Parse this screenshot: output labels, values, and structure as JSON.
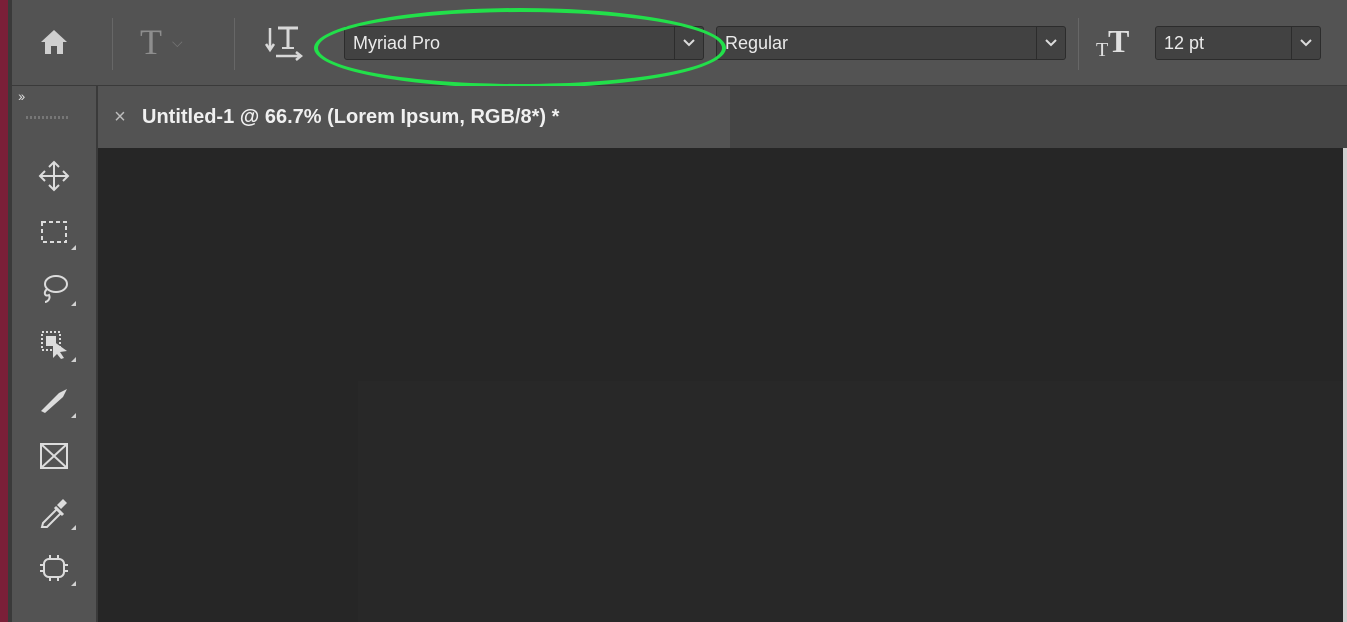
{
  "options_bar": {
    "font_family": "Myriad Pro",
    "font_style": "Regular",
    "font_size": "12 pt",
    "type_tool_glyph": "T",
    "size_glyph": "T",
    "home_icon": "home-icon",
    "orientation_icon": "text-orientation-icon"
  },
  "document_tab": {
    "close_glyph": "×",
    "title": "Untitled-1 @ 66.7% (Lorem Ipsum, RGB/8*) *"
  },
  "toolbar": {
    "collapse_glyph": "››",
    "tools": [
      {
        "name": "move-tool-icon"
      },
      {
        "name": "marquee-tool-icon"
      },
      {
        "name": "lasso-tool-icon"
      },
      {
        "name": "object-selection-tool-icon"
      },
      {
        "name": "crop-tool-icon"
      },
      {
        "name": "frame-tool-icon"
      },
      {
        "name": "eyedropper-tool-icon"
      },
      {
        "name": "spot-healing-tool-icon"
      }
    ]
  },
  "colors": {
    "highlight": "#22e04a",
    "panel": "#535353",
    "canvas": "#262626"
  }
}
